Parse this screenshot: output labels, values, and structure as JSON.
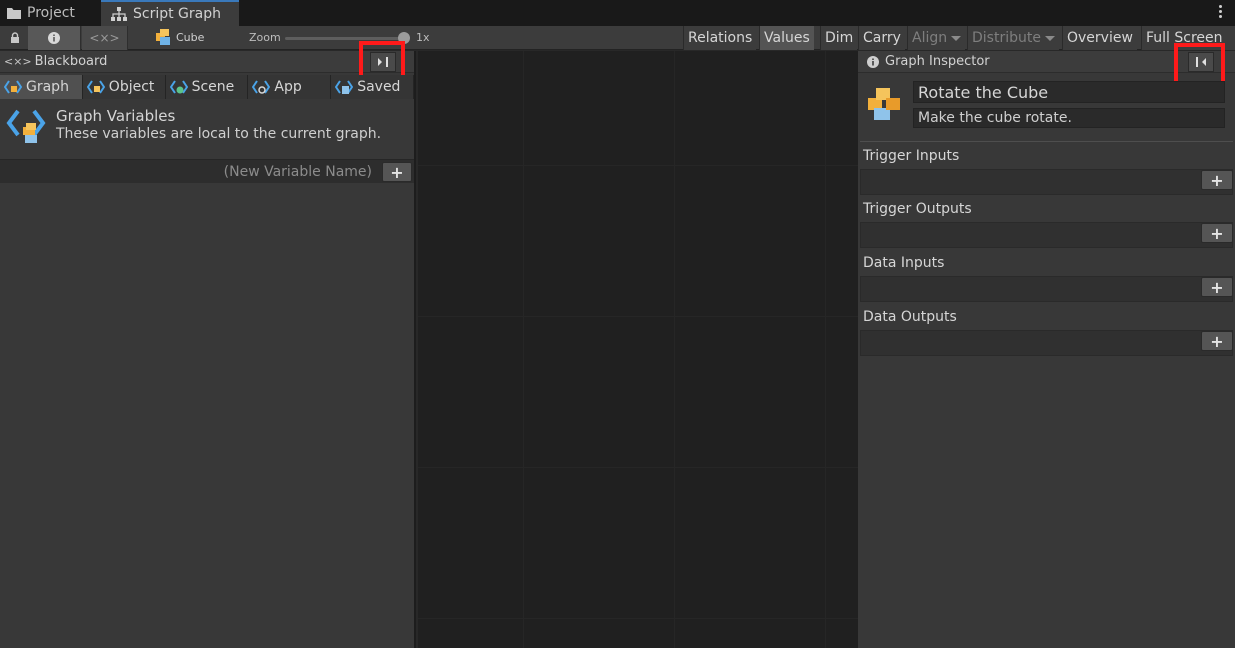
{
  "tabs": {
    "project": "Project",
    "script_graph": "Script Graph"
  },
  "toolbar": {
    "object_name": "Cube",
    "zoom_label": "Zoom",
    "zoom_value": "1x",
    "zoom_level": 1,
    "buttons": {
      "relations": "Relations",
      "values": "Values",
      "dim": "Dim",
      "carry": "Carry",
      "align": "Align",
      "distribute": "Distribute",
      "overview": "Overview",
      "full_screen": "Full Screen"
    }
  },
  "blackboard": {
    "title": "Blackboard",
    "tabs": [
      "Graph",
      "Object",
      "Scene",
      "App",
      "Saved"
    ],
    "active_tab": "Graph",
    "section_title": "Graph Variables",
    "section_desc": "These variables are local to the current graph.",
    "new_var_placeholder": "(New Variable Name)"
  },
  "inspector": {
    "title": "Graph Inspector",
    "graph_title": "Rotate the Cube",
    "graph_summary": "Make the cube rotate.",
    "sections": [
      "Trigger Inputs",
      "Trigger Outputs",
      "Data Inputs",
      "Data Outputs"
    ]
  },
  "colors": {
    "highlight": "#ff1a1a",
    "accent": "#3a79bb"
  }
}
